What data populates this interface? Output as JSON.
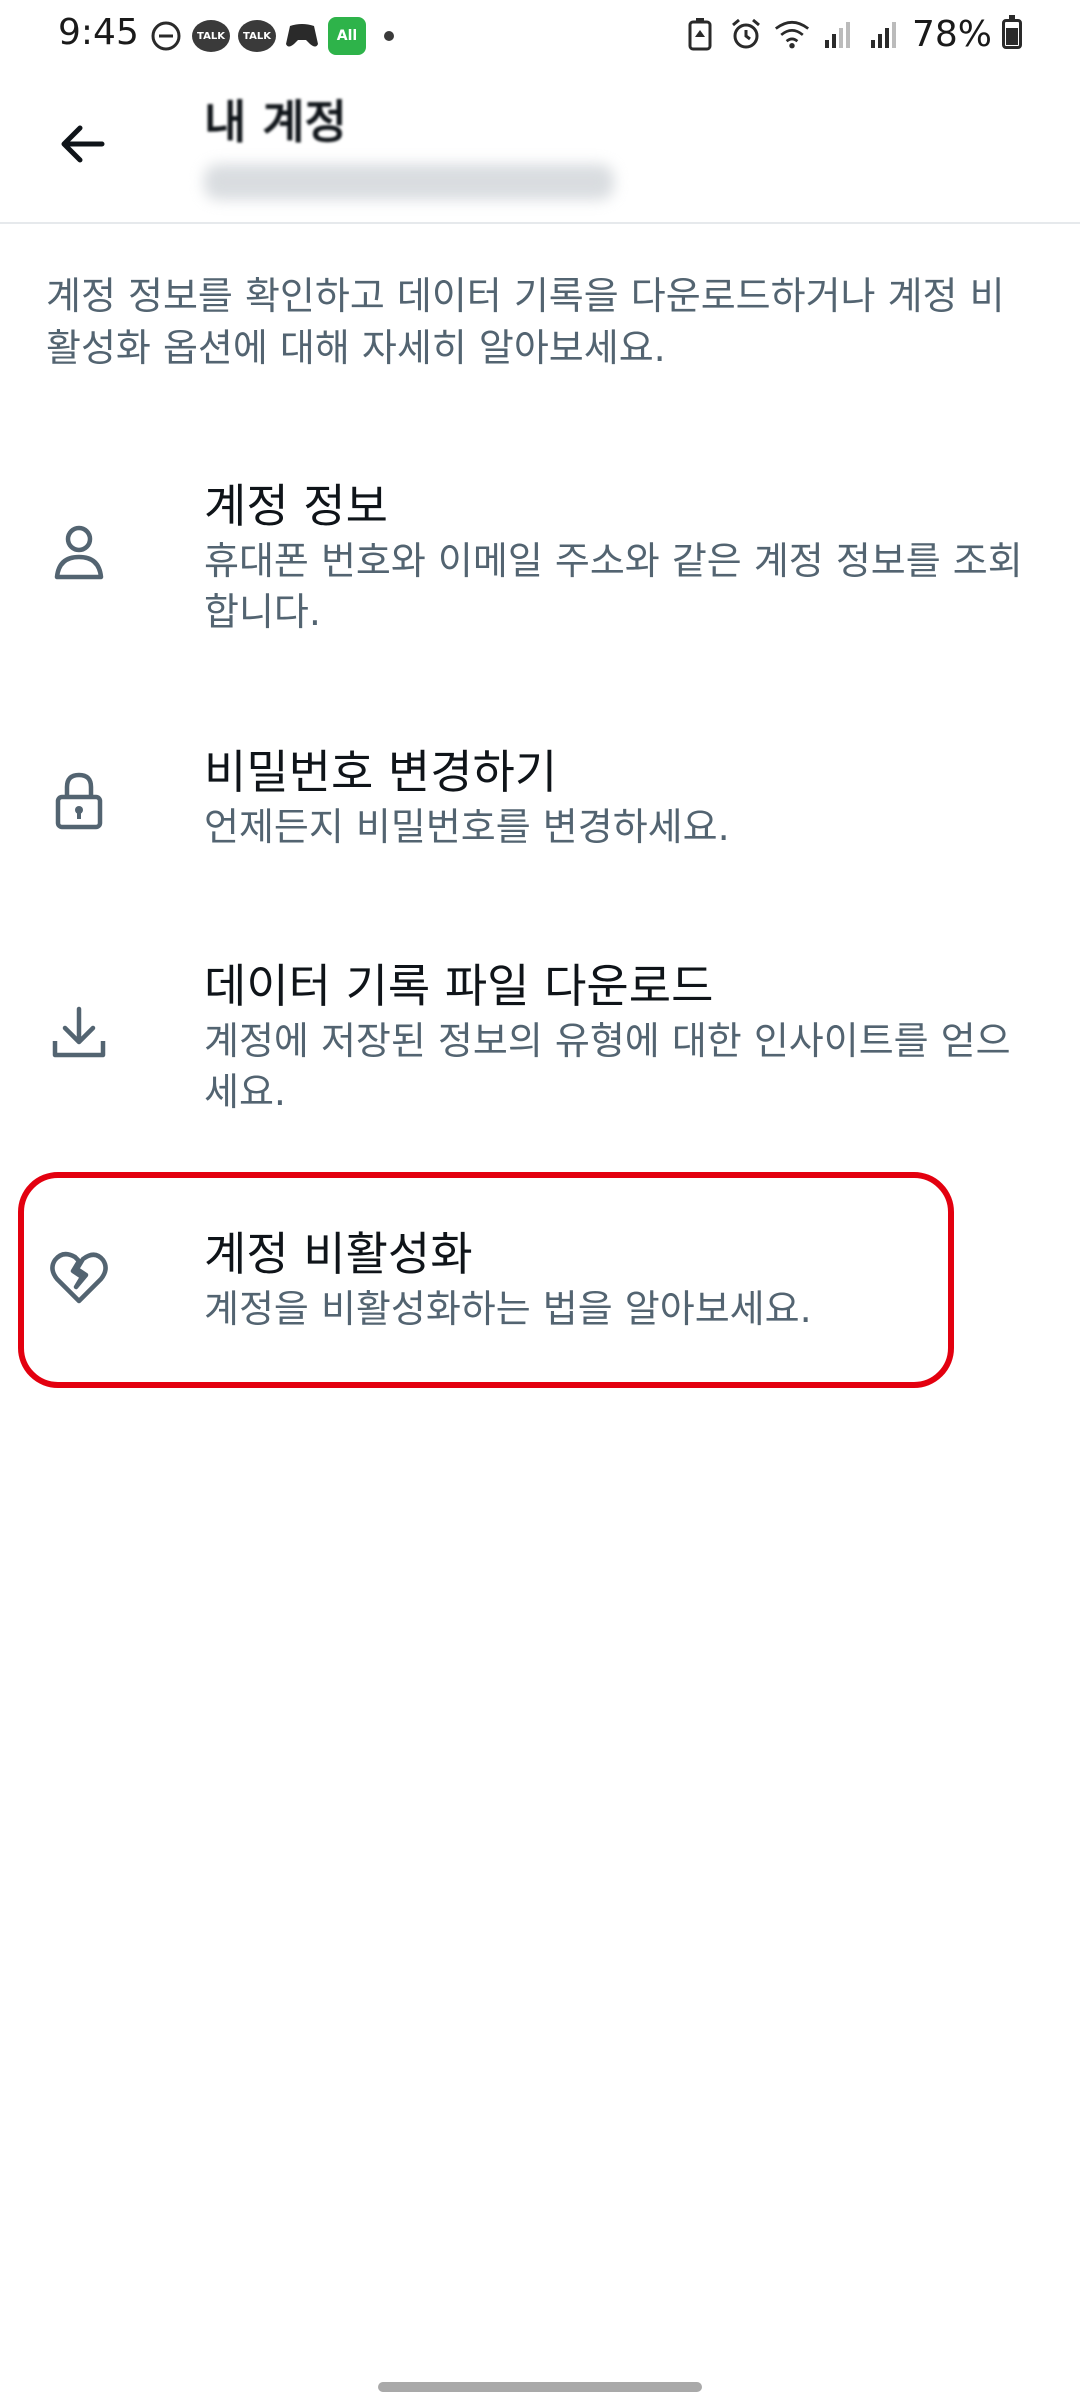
{
  "status_bar": {
    "time": "9:45",
    "battery": "78%",
    "battery_level": 0.78,
    "left_icons": [
      "do-not-disturb-icon",
      "kakaotalk-icon",
      "kakaotalk-icon",
      "game-icon",
      "all-app-icon",
      "notification-dot"
    ],
    "talk_label": "TALK",
    "all_label": "All",
    "right_icons": [
      "battery-saver-icon",
      "alarm-icon",
      "wifi-icon",
      "signal-icon",
      "signal-icon"
    ]
  },
  "header": {
    "title": "내 계정"
  },
  "intro": "계정 정보를 확인하고 데이터 기록을 다운로드하거나 계정 비활성화 옵션에 대해 자세히 알아보세요.",
  "items": [
    {
      "icon": "person-icon",
      "title": "계정 정보",
      "description": "휴대폰 번호와 이메일 주소와 같은 계정 정보를 조회합니다."
    },
    {
      "icon": "lock-icon",
      "title": "비밀번호 변경하기",
      "description": "언제든지 비밀번호를 변경하세요."
    },
    {
      "icon": "download-icon",
      "title": "데이터 기록 파일 다운로드",
      "description": "계정에 저장된 정보의 유형에 대한 인사이트를 얻으세요."
    },
    {
      "icon": "broken-heart-icon",
      "title": "계정 비활성화",
      "description": "계정을 비활성화하는 법을 알아보세요."
    }
  ],
  "colors": {
    "text": "#0f1419",
    "secondary": "#536471",
    "highlight": "#e3000f",
    "divider": "#e6e9ec"
  }
}
